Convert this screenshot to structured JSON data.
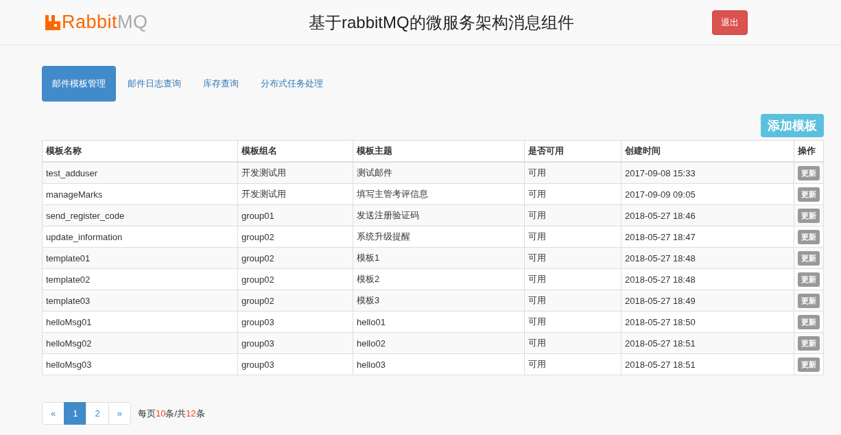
{
  "header": {
    "logo": [
      {
        "text": "Rabbit",
        "accent": true
      },
      {
        "text": "MQ",
        "accent": false
      }
    ],
    "title": "基于rabbitMQ的微服务架构消息组件",
    "logout": "退出"
  },
  "tabs": [
    {
      "label": "邮件模板管理",
      "selected": true
    },
    {
      "label": "邮件日志查询",
      "selected": false
    },
    {
      "label": "库存查询",
      "selected": false
    },
    {
      "label": "分布式任务处理",
      "selected": false
    }
  ],
  "add_button": "添加模板",
  "table": {
    "columns": [
      "模板名称",
      "模板组名",
      "模板主题",
      "是否可用",
      "创建时间",
      "操作"
    ],
    "rows": [
      {
        "cells": [
          "test_adduser",
          "开发测试用",
          "测试邮件",
          "可用",
          "2017-09-08 15:33"
        ],
        "action": "更新"
      },
      {
        "cells": [
          "manageMarks",
          "开发测试用",
          "填写主管考评信息",
          "可用",
          "2017-09-09 09:05"
        ],
        "action": "更新"
      },
      {
        "cells": [
          "send_register_code",
          "group01",
          "发送注册验证码",
          "可用",
          "2018-05-27 18:46"
        ],
        "action": "更新"
      },
      {
        "cells": [
          "update_information",
          "group02",
          "系统升级提醒",
          "可用",
          "2018-05-27 18:47"
        ],
        "action": "更新"
      },
      {
        "cells": [
          "template01",
          "group02",
          "模板1",
          "可用",
          "2018-05-27 18:48"
        ],
        "action": "更新"
      },
      {
        "cells": [
          "template02",
          "group02",
          "模板2",
          "可用",
          "2018-05-27 18:48"
        ],
        "action": "更新"
      },
      {
        "cells": [
          "template03",
          "group02",
          "模板3",
          "可用",
          "2018-05-27 18:49"
        ],
        "action": "更新"
      },
      {
        "cells": [
          "helloMsg01",
          "group03",
          "hello01",
          "可用",
          "2018-05-27 18:50"
        ],
        "action": "更新"
      },
      {
        "cells": [
          "helloMsg02",
          "group03",
          "hello02",
          "可用",
          "2018-05-27 18:51"
        ],
        "action": "更新"
      },
      {
        "cells": [
          "helloMsg03",
          "group03",
          "hello03",
          "可用",
          "2018-05-27 18:51"
        ],
        "action": "更新"
      }
    ]
  },
  "pagination": {
    "prev": "«",
    "pages": [
      {
        "label": "1",
        "selected": true
      },
      {
        "label": "2",
        "selected": false
      }
    ],
    "next": "»",
    "summary": [
      {
        "text": "每页",
        "highlight": false
      },
      {
        "text": "10",
        "highlight": true
      },
      {
        "text": "条/共",
        "highlight": false
      },
      {
        "text": "12",
        "highlight": true
      },
      {
        "text": "条",
        "highlight": false
      }
    ]
  }
}
